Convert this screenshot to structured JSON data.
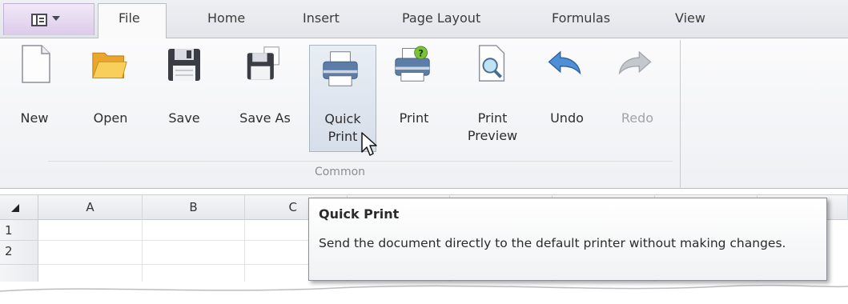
{
  "app_menu": {
    "icon": "app-menu-icon",
    "accent": "#dccbe9"
  },
  "tabs": [
    {
      "label": "File",
      "active": true
    },
    {
      "label": "Home"
    },
    {
      "label": "Insert"
    },
    {
      "label": "Page Layout"
    },
    {
      "label": "Formulas"
    },
    {
      "label": "View"
    }
  ],
  "ribbon": {
    "group_label": "Common",
    "buttons": [
      {
        "label": "New",
        "icon": "new-document-icon"
      },
      {
        "label": "Open",
        "icon": "open-folder-icon"
      },
      {
        "label": "Save",
        "icon": "save-icon"
      },
      {
        "label": "Save As",
        "icon": "save-as-icon"
      },
      {
        "label": "Quick\nPrint",
        "icon": "quick-print-icon",
        "hovered": true
      },
      {
        "label": "Print",
        "icon": "print-icon"
      },
      {
        "label": "Print\nPreview",
        "icon": "print-preview-icon"
      },
      {
        "label": "Undo",
        "icon": "undo-icon"
      },
      {
        "label": "Redo",
        "icon": "redo-icon",
        "disabled": true
      }
    ]
  },
  "sheet": {
    "columns": [
      "A",
      "B",
      "C"
    ],
    "rows": [
      "1",
      "2"
    ]
  },
  "tooltip": {
    "title": "Quick Print",
    "text": "Send the document directly to the default printer without making changes."
  }
}
